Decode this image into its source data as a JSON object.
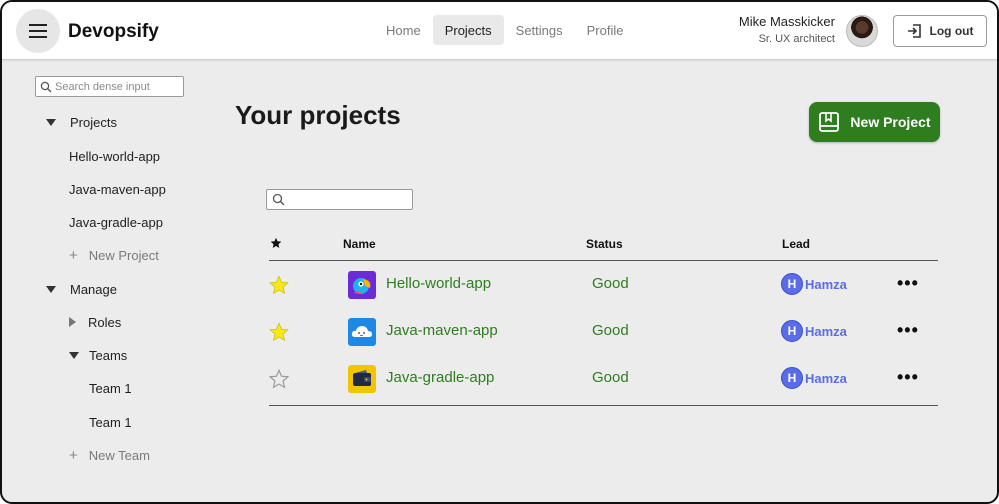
{
  "app": {
    "brand": "Devopsify"
  },
  "nav": {
    "tabs": [
      "Home",
      "Projects",
      "Settings",
      "Profile"
    ],
    "active": "Projects"
  },
  "user": {
    "name": "Mike Masskicker",
    "role": "Sr. UX architect",
    "logout_label": "Log out"
  },
  "sidebar": {
    "search_placeholder": "Search dense input",
    "projects_label": "Projects",
    "projects": [
      "Hello-world-app",
      "Java-maven-app",
      "Java-gradle-app"
    ],
    "new_project_label": "New Project",
    "manage_label": "Manage",
    "roles_label": "Roles",
    "teams_label": "Teams",
    "teams": [
      "Team 1",
      "Team 1"
    ],
    "new_team_label": "New Team"
  },
  "main": {
    "title": "Your projects",
    "new_project_button": "New Project",
    "table": {
      "columns": {
        "star": "",
        "name": "Name",
        "status": "Status",
        "lead": "Lead"
      },
      "rows": [
        {
          "starred": true,
          "name": "Hello-world-app",
          "status": "Good",
          "lead": "Hamza",
          "lead_initial": "H",
          "icon": "parrot-icon",
          "icon_color": "#6a2bd9"
        },
        {
          "starred": true,
          "name": "Java-maven-app",
          "status": "Good",
          "lead": "Hamza",
          "lead_initial": "H",
          "icon": "cloud-icon",
          "icon_color": "#1e88e5"
        },
        {
          "starred": false,
          "name": "Java-gradle-app",
          "status": "Good",
          "lead": "Hamza",
          "lead_initial": "H",
          "icon": "wallet-icon",
          "icon_color": "#f5c400"
        }
      ]
    }
  },
  "colors": {
    "accent_green": "#2e7d1f",
    "lead_blue": "#5b6ce8",
    "star_yellow": "#f7e81a"
  }
}
